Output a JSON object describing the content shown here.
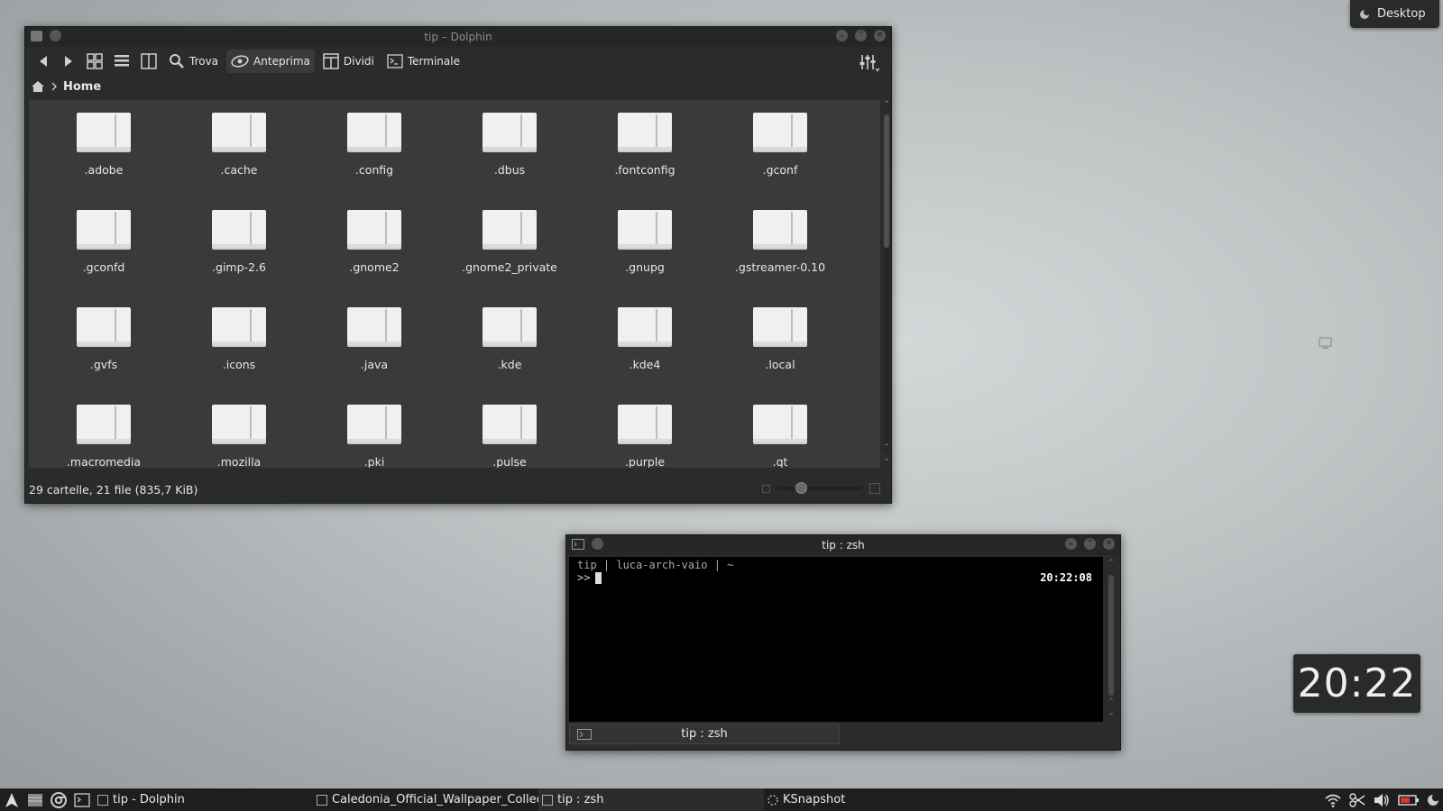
{
  "desktop": {
    "button_label": "Desktop"
  },
  "dolphin": {
    "title": "tip – Dolphin",
    "toolbar": {
      "find": "Trova",
      "preview": "Anteprima",
      "split": "Dividi",
      "terminal": "Terminale"
    },
    "breadcrumb": {
      "current": "Home"
    },
    "items": [
      ".adobe",
      ".cache",
      ".config",
      ".dbus",
      ".fontconfig",
      ".gconf",
      ".gconfd",
      ".gimp-2.6",
      ".gnome2",
      ".gnome2_private",
      ".gnupg",
      ".gstreamer-0.10",
      ".gvfs",
      ".icons",
      ".java",
      ".kde",
      ".kde4",
      ".local",
      ".macromedia",
      ".mozilla",
      ".pki",
      ".pulse",
      ".purple",
      ".qt"
    ],
    "status": "29 cartelle, 21 file (835,7 KiB)",
    "zoom_level": 0.25
  },
  "konsole": {
    "title": "tip : zsh",
    "prompt_line1": "tip | luca-arch-vaio | ~",
    "prompt_line2": ">>",
    "right_clock": "20:22:08",
    "tab_label": "tip : zsh"
  },
  "clock_widget": {
    "time": "20:22"
  },
  "taskbar": {
    "tasks": [
      {
        "label": "tip - Dolphin"
      },
      {
        "label": "Caledonia_Official_Wallpaper_Collecti"
      },
      {
        "label": "tip : zsh"
      },
      {
        "label": "KSnapshot"
      }
    ]
  },
  "colors": {
    "window_bg": "#2b2b2b",
    "view_bg": "#3a3a3a",
    "taskbar_bg": "#1e1e1e",
    "terminal_bg": "#000000"
  }
}
